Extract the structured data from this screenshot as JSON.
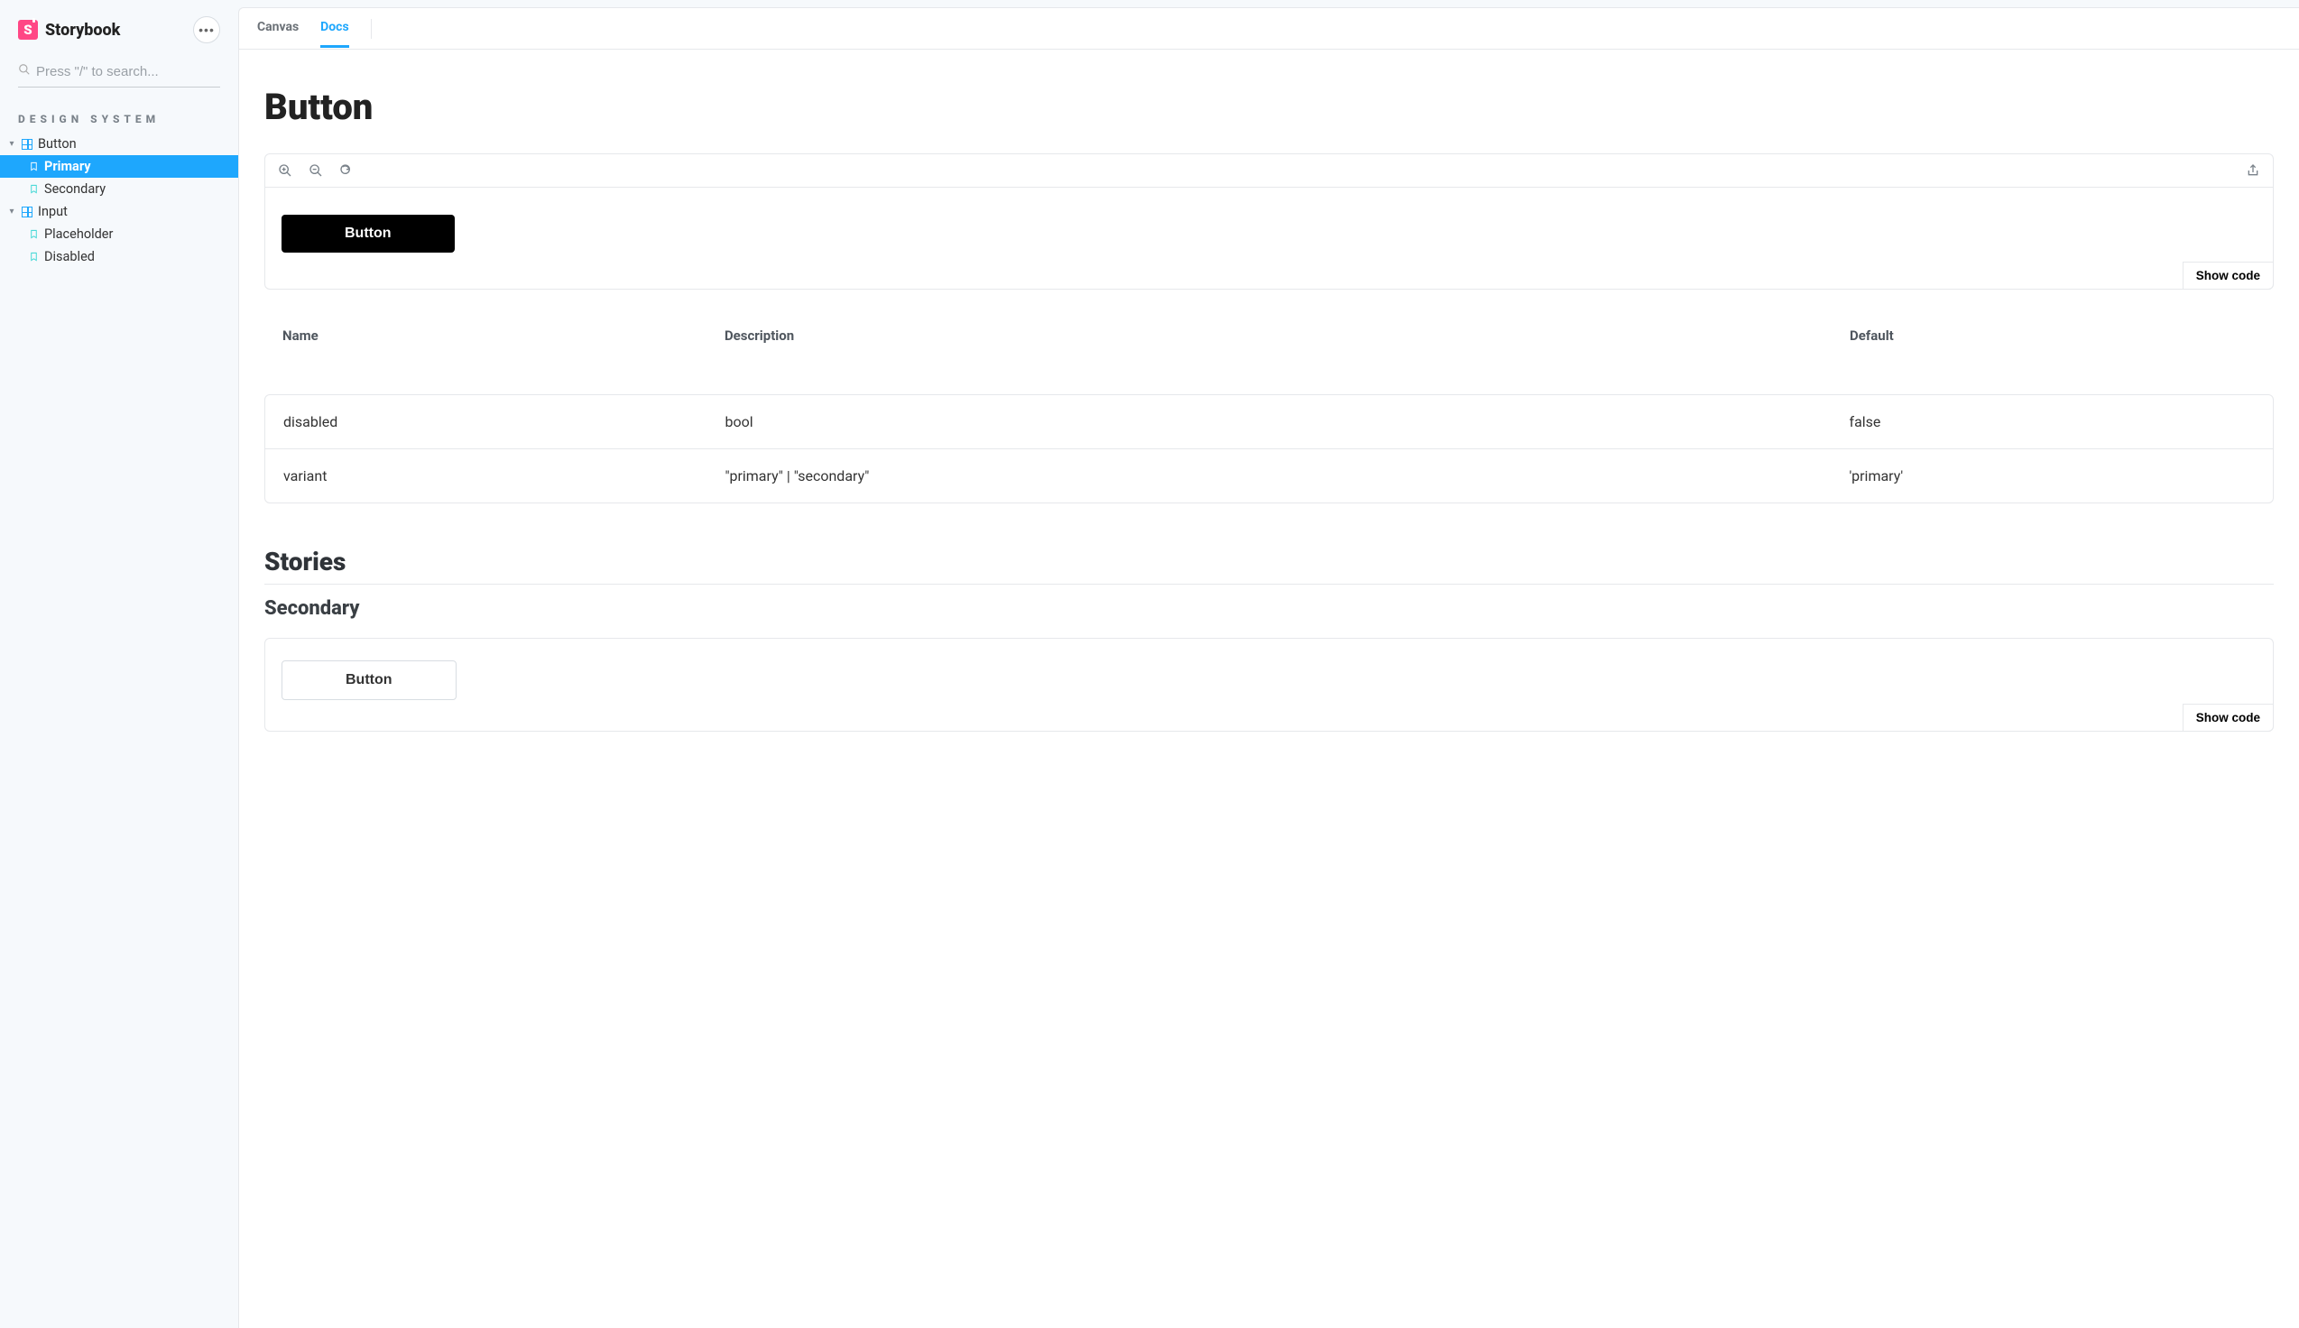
{
  "brand": {
    "name": "Storybook"
  },
  "sidebar": {
    "search_placeholder": "Press \"/\" to search...",
    "section_label": "DESIGN SYSTEM",
    "items": [
      {
        "label": "Button",
        "children": [
          {
            "label": "Primary",
            "selected": true
          },
          {
            "label": "Secondary"
          }
        ]
      },
      {
        "label": "Input",
        "children": [
          {
            "label": "Placeholder"
          },
          {
            "label": "Disabled"
          }
        ]
      }
    ]
  },
  "tabs": {
    "canvas": "Canvas",
    "docs": "Docs",
    "active": "docs"
  },
  "doc": {
    "title": "Button",
    "preview": {
      "button_label": "Button",
      "show_code": "Show code"
    },
    "args": {
      "headers": {
        "name": "Name",
        "description": "Description",
        "default": "Default"
      },
      "rows": [
        {
          "name": "disabled",
          "description": "bool",
          "default": "false"
        },
        {
          "name": "variant",
          "description": "\"primary\" | \"secondary\"",
          "default": "'primary'"
        }
      ]
    },
    "stories": {
      "heading": "Stories",
      "secondary": {
        "heading": "Secondary",
        "button_label": "Button",
        "show_code": "Show code"
      }
    }
  }
}
